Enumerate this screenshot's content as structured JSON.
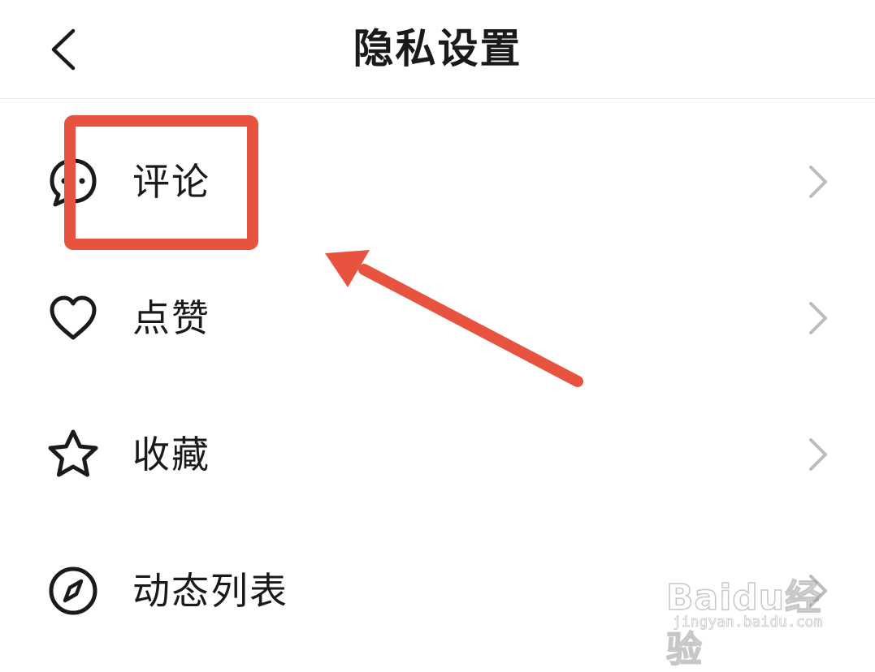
{
  "header": {
    "title": "隐私设置",
    "back_icon": "back-chevron-icon"
  },
  "menu": {
    "items": [
      {
        "label": "评论",
        "icon": "comment-bubble-icon"
      },
      {
        "label": "点赞",
        "icon": "heart-icon"
      },
      {
        "label": "收藏",
        "icon": "star-icon"
      },
      {
        "label": "动态列表",
        "icon": "compass-icon"
      }
    ],
    "chevron_icon": "chevron-right-icon"
  },
  "annotation": {
    "highlight_color": "#e8533f",
    "arrow_color": "#e8533f"
  },
  "watermark": {
    "logo_text": "Baidu经验",
    "url": "jingyan.baidu.com"
  },
  "colors": {
    "text": "#1a1a1a",
    "chevron": "#bdbdbd",
    "divider": "#ececec"
  }
}
